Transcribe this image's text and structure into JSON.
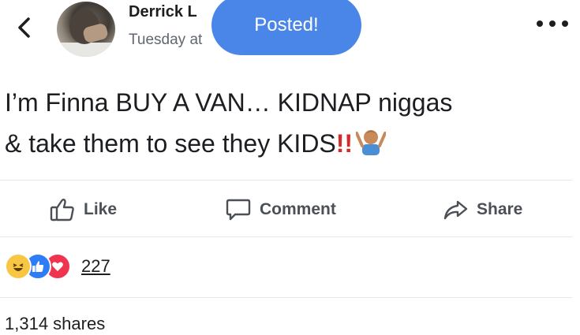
{
  "header": {
    "author_name": "Derrick L",
    "post_time": "Tuesday at"
  },
  "toast": {
    "text": "Posted!"
  },
  "post": {
    "line1": "I’m Finna BUY A VAN… KIDNAP niggas",
    "line2": "& take them to see they KIDS",
    "emphasis": "!!",
    "emoji": "man-shrugging-emoji"
  },
  "actions": {
    "like_label": "Like",
    "comment_label": "Comment",
    "share_label": "Share"
  },
  "reactions": {
    "types": [
      "haha",
      "like",
      "love"
    ],
    "count": "227"
  },
  "shares": {
    "text": "1,314 shares"
  },
  "colors": {
    "toast_bg": "#4a86e8",
    "like_reaction": "#2e7cf6",
    "love_reaction": "#f0334f",
    "haha_reaction": "#f7c744",
    "emphasis": "#d42a2a"
  }
}
